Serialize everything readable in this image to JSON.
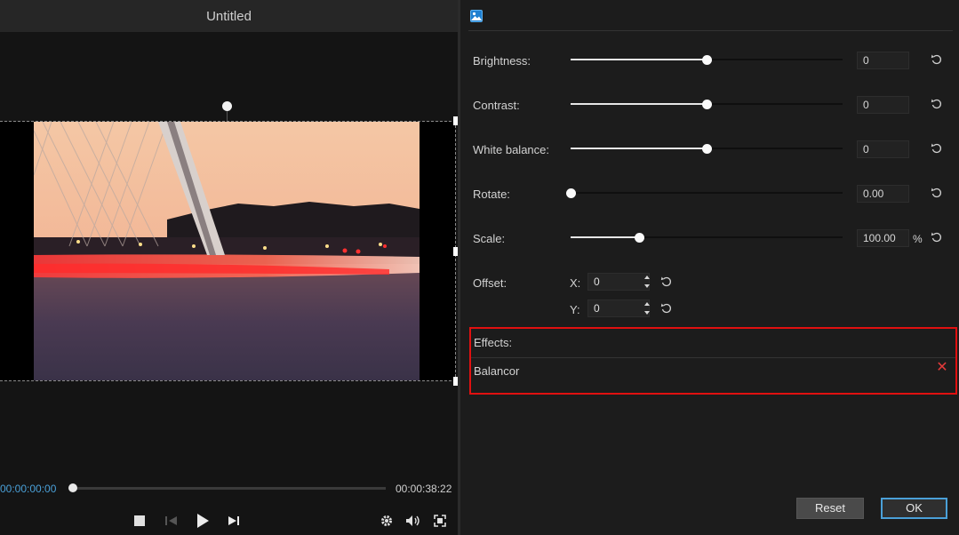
{
  "window": {
    "title": "Untitled"
  },
  "player": {
    "current_time": "00:00:00:00",
    "duration": "00:00:38:22",
    "progress_fraction": 0.0,
    "controls": [
      "stop-icon",
      "prev-frame-icon",
      "play-icon",
      "next-frame-icon",
      "settings-icon",
      "volume-icon",
      "fullscreen-icon"
    ]
  },
  "adjust": {
    "tab_icon": "image-icon",
    "brightness": {
      "label": "Brightness:",
      "value": "0",
      "fraction": 0.5
    },
    "contrast": {
      "label": "Contrast:",
      "value": "0",
      "fraction": 0.5
    },
    "white_balance": {
      "label": "White balance:",
      "value": "0",
      "fraction": 0.5
    },
    "rotate": {
      "label": "Rotate:",
      "value": "0.00",
      "fraction": 0.0
    },
    "scale": {
      "label": "Scale:",
      "value": "100.00",
      "unit": "%",
      "fraction": 0.25
    },
    "offset": {
      "label": "Offset:",
      "x_label": "X:",
      "x_value": "0",
      "y_label": "Y:",
      "y_value": "0"
    }
  },
  "effects": {
    "label": "Effects:",
    "items": [
      {
        "name": "Balancor"
      }
    ]
  },
  "buttons": {
    "reset": "Reset",
    "ok": "OK"
  },
  "colors": {
    "accent": "#4aa0d8",
    "highlight_border": "#e01010",
    "remove": "#e33a3a"
  }
}
